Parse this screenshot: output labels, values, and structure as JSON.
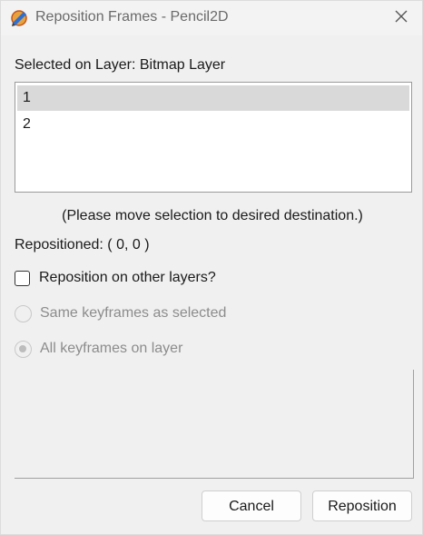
{
  "window": {
    "title": "Reposition Frames - Pencil2D",
    "app_icon": "pencil2d-logo-icon",
    "close_icon": "close-icon"
  },
  "layer_label": "Selected on Layer: Bitmap Layer",
  "frames_list": [
    {
      "label": "1",
      "selected": true
    },
    {
      "label": "2",
      "selected": false
    }
  ],
  "hint": "(Please move selection to desired destination.)",
  "repositioned": "Repositioned: ( 0, 0 )",
  "other_layers_checkbox": {
    "label": "Reposition on other layers?",
    "checked": false
  },
  "radio_options": [
    {
      "label": "Same keyframes as selected",
      "checked": false,
      "enabled": false
    },
    {
      "label": "All keyframes on layer",
      "checked": true,
      "enabled": false
    }
  ],
  "buttons": {
    "cancel": "Cancel",
    "reposition": "Reposition"
  },
  "colors": {
    "selection_bg": "#d9d9d9",
    "disabled_text": "#8c8c8c",
    "window_bg": "#f0f0f0"
  }
}
